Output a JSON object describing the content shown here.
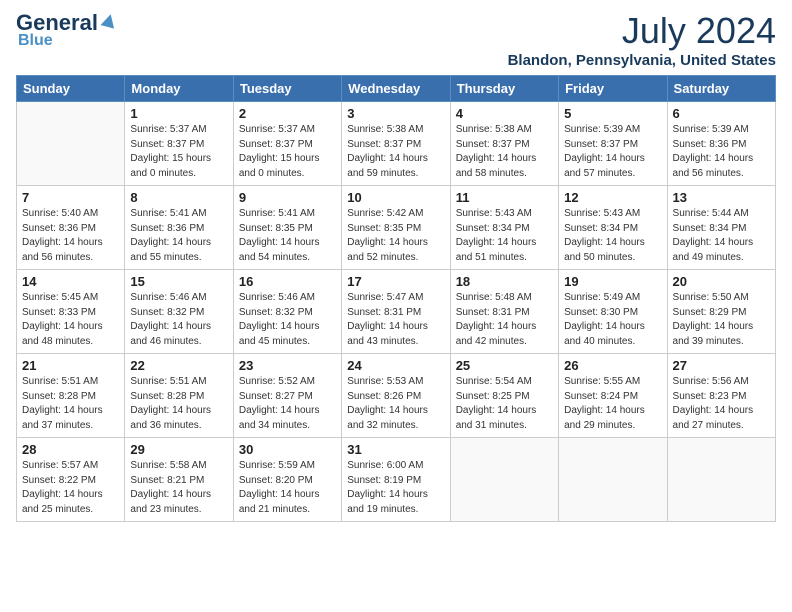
{
  "header": {
    "logo_general": "General",
    "logo_blue": "Blue",
    "month_title": "July 2024",
    "location": "Blandon, Pennsylvania, United States"
  },
  "days_of_week": [
    "Sunday",
    "Monday",
    "Tuesday",
    "Wednesday",
    "Thursday",
    "Friday",
    "Saturday"
  ],
  "weeks": [
    [
      {
        "day": "",
        "sunrise": "",
        "sunset": "",
        "daylight": ""
      },
      {
        "day": "1",
        "sunrise": "Sunrise: 5:37 AM",
        "sunset": "Sunset: 8:37 PM",
        "daylight": "Daylight: 15 hours and 0 minutes."
      },
      {
        "day": "2",
        "sunrise": "Sunrise: 5:37 AM",
        "sunset": "Sunset: 8:37 PM",
        "daylight": "Daylight: 15 hours and 0 minutes."
      },
      {
        "day": "3",
        "sunrise": "Sunrise: 5:38 AM",
        "sunset": "Sunset: 8:37 PM",
        "daylight": "Daylight: 14 hours and 59 minutes."
      },
      {
        "day": "4",
        "sunrise": "Sunrise: 5:38 AM",
        "sunset": "Sunset: 8:37 PM",
        "daylight": "Daylight: 14 hours and 58 minutes."
      },
      {
        "day": "5",
        "sunrise": "Sunrise: 5:39 AM",
        "sunset": "Sunset: 8:37 PM",
        "daylight": "Daylight: 14 hours and 57 minutes."
      },
      {
        "day": "6",
        "sunrise": "Sunrise: 5:39 AM",
        "sunset": "Sunset: 8:36 PM",
        "daylight": "Daylight: 14 hours and 56 minutes."
      }
    ],
    [
      {
        "day": "7",
        "sunrise": "Sunrise: 5:40 AM",
        "sunset": "Sunset: 8:36 PM",
        "daylight": "Daylight: 14 hours and 56 minutes."
      },
      {
        "day": "8",
        "sunrise": "Sunrise: 5:41 AM",
        "sunset": "Sunset: 8:36 PM",
        "daylight": "Daylight: 14 hours and 55 minutes."
      },
      {
        "day": "9",
        "sunrise": "Sunrise: 5:41 AM",
        "sunset": "Sunset: 8:35 PM",
        "daylight": "Daylight: 14 hours and 54 minutes."
      },
      {
        "day": "10",
        "sunrise": "Sunrise: 5:42 AM",
        "sunset": "Sunset: 8:35 PM",
        "daylight": "Daylight: 14 hours and 52 minutes."
      },
      {
        "day": "11",
        "sunrise": "Sunrise: 5:43 AM",
        "sunset": "Sunset: 8:34 PM",
        "daylight": "Daylight: 14 hours and 51 minutes."
      },
      {
        "day": "12",
        "sunrise": "Sunrise: 5:43 AM",
        "sunset": "Sunset: 8:34 PM",
        "daylight": "Daylight: 14 hours and 50 minutes."
      },
      {
        "day": "13",
        "sunrise": "Sunrise: 5:44 AM",
        "sunset": "Sunset: 8:34 PM",
        "daylight": "Daylight: 14 hours and 49 minutes."
      }
    ],
    [
      {
        "day": "14",
        "sunrise": "Sunrise: 5:45 AM",
        "sunset": "Sunset: 8:33 PM",
        "daylight": "Daylight: 14 hours and 48 minutes."
      },
      {
        "day": "15",
        "sunrise": "Sunrise: 5:46 AM",
        "sunset": "Sunset: 8:32 PM",
        "daylight": "Daylight: 14 hours and 46 minutes."
      },
      {
        "day": "16",
        "sunrise": "Sunrise: 5:46 AM",
        "sunset": "Sunset: 8:32 PM",
        "daylight": "Daylight: 14 hours and 45 minutes."
      },
      {
        "day": "17",
        "sunrise": "Sunrise: 5:47 AM",
        "sunset": "Sunset: 8:31 PM",
        "daylight": "Daylight: 14 hours and 43 minutes."
      },
      {
        "day": "18",
        "sunrise": "Sunrise: 5:48 AM",
        "sunset": "Sunset: 8:31 PM",
        "daylight": "Daylight: 14 hours and 42 minutes."
      },
      {
        "day": "19",
        "sunrise": "Sunrise: 5:49 AM",
        "sunset": "Sunset: 8:30 PM",
        "daylight": "Daylight: 14 hours and 40 minutes."
      },
      {
        "day": "20",
        "sunrise": "Sunrise: 5:50 AM",
        "sunset": "Sunset: 8:29 PM",
        "daylight": "Daylight: 14 hours and 39 minutes."
      }
    ],
    [
      {
        "day": "21",
        "sunrise": "Sunrise: 5:51 AM",
        "sunset": "Sunset: 8:28 PM",
        "daylight": "Daylight: 14 hours and 37 minutes."
      },
      {
        "day": "22",
        "sunrise": "Sunrise: 5:51 AM",
        "sunset": "Sunset: 8:28 PM",
        "daylight": "Daylight: 14 hours and 36 minutes."
      },
      {
        "day": "23",
        "sunrise": "Sunrise: 5:52 AM",
        "sunset": "Sunset: 8:27 PM",
        "daylight": "Daylight: 14 hours and 34 minutes."
      },
      {
        "day": "24",
        "sunrise": "Sunrise: 5:53 AM",
        "sunset": "Sunset: 8:26 PM",
        "daylight": "Daylight: 14 hours and 32 minutes."
      },
      {
        "day": "25",
        "sunrise": "Sunrise: 5:54 AM",
        "sunset": "Sunset: 8:25 PM",
        "daylight": "Daylight: 14 hours and 31 minutes."
      },
      {
        "day": "26",
        "sunrise": "Sunrise: 5:55 AM",
        "sunset": "Sunset: 8:24 PM",
        "daylight": "Daylight: 14 hours and 29 minutes."
      },
      {
        "day": "27",
        "sunrise": "Sunrise: 5:56 AM",
        "sunset": "Sunset: 8:23 PM",
        "daylight": "Daylight: 14 hours and 27 minutes."
      }
    ],
    [
      {
        "day": "28",
        "sunrise": "Sunrise: 5:57 AM",
        "sunset": "Sunset: 8:22 PM",
        "daylight": "Daylight: 14 hours and 25 minutes."
      },
      {
        "day": "29",
        "sunrise": "Sunrise: 5:58 AM",
        "sunset": "Sunset: 8:21 PM",
        "daylight": "Daylight: 14 hours and 23 minutes."
      },
      {
        "day": "30",
        "sunrise": "Sunrise: 5:59 AM",
        "sunset": "Sunset: 8:20 PM",
        "daylight": "Daylight: 14 hours and 21 minutes."
      },
      {
        "day": "31",
        "sunrise": "Sunrise: 6:00 AM",
        "sunset": "Sunset: 8:19 PM",
        "daylight": "Daylight: 14 hours and 19 minutes."
      },
      {
        "day": "",
        "sunrise": "",
        "sunset": "",
        "daylight": ""
      },
      {
        "day": "",
        "sunrise": "",
        "sunset": "",
        "daylight": ""
      },
      {
        "day": "",
        "sunrise": "",
        "sunset": "",
        "daylight": ""
      }
    ]
  ]
}
